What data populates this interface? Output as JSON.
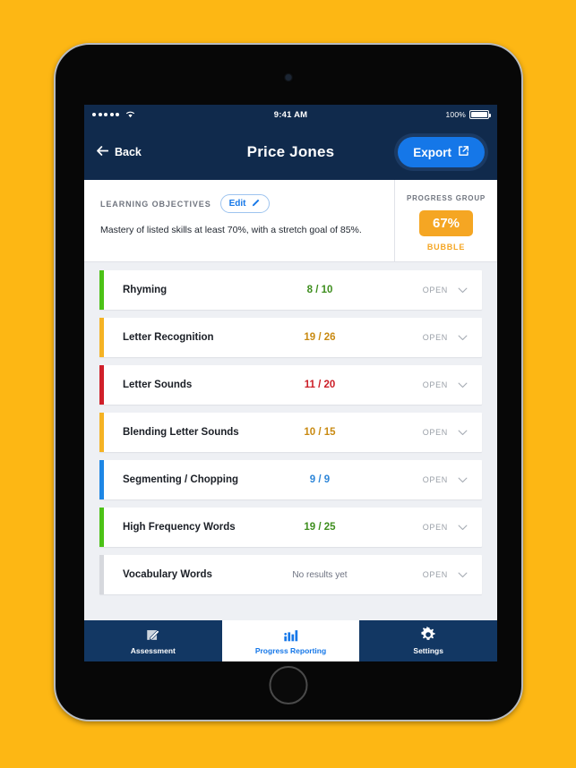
{
  "status_bar": {
    "signal_icon": "signal-dots-icon",
    "wifi_icon": "wifi-icon",
    "time": "9:41 AM",
    "battery_percent": "100%",
    "battery_icon": "battery-full-icon"
  },
  "nav": {
    "back_label": "Back",
    "back_icon": "arrow-left-icon",
    "title": "Price Jones",
    "export_label": "Export",
    "export_icon": "external-link-icon"
  },
  "objectives": {
    "label": "LEARNING OBJECTIVES",
    "edit_label": "Edit",
    "edit_icon": "pencil-icon",
    "text": "Mastery of listed skills at least 70%, with a stretch goal of 85%."
  },
  "progress_group": {
    "label": "PROGRESS GROUP",
    "value": "67%",
    "caption": "BUBBLE",
    "color": "#F5A623"
  },
  "skills": {
    "open_label": "OPEN",
    "chevron_icon": "chevron-down-icon",
    "items": [
      {
        "name": "Rhyming",
        "score": "8 / 10",
        "color": "#4CC217",
        "score_color": "#3E8E1E",
        "has_score": true
      },
      {
        "name": "Letter Recognition",
        "score": "19 / 26",
        "color": "#F5B324",
        "score_color": "#C98A12",
        "has_score": true
      },
      {
        "name": "Letter Sounds",
        "score": "11 / 20",
        "color": "#D0202A",
        "score_color": "#CC1E27",
        "has_score": true
      },
      {
        "name": "Blending Letter Sounds",
        "score": "10 / 15",
        "color": "#F5B324",
        "score_color": "#C98A12",
        "has_score": true
      },
      {
        "name": "Segmenting / Chopping",
        "score": "9 / 9",
        "color": "#1E87E5",
        "score_color": "#2E86D8",
        "has_score": true
      },
      {
        "name": "High Frequency Words",
        "score": "19 / 25",
        "color": "#4CC217",
        "score_color": "#3E8E1E",
        "has_score": true
      },
      {
        "name": "Vocabulary Words",
        "score": "No results yet",
        "color": "#D6D8DD",
        "score_color": "#6D7280",
        "has_score": false
      }
    ]
  },
  "tabs": [
    {
      "label": "Assessment",
      "icon": "pencil-square-icon",
      "active": false
    },
    {
      "label": "Progress Reporting",
      "icon": "bar-chart-icon",
      "active": true
    },
    {
      "label": "Settings",
      "icon": "gear-icon",
      "active": false
    }
  ],
  "theme": {
    "page_background": "#FDB714",
    "navy": "#102a4c",
    "accent_blue": "#1577e8"
  }
}
